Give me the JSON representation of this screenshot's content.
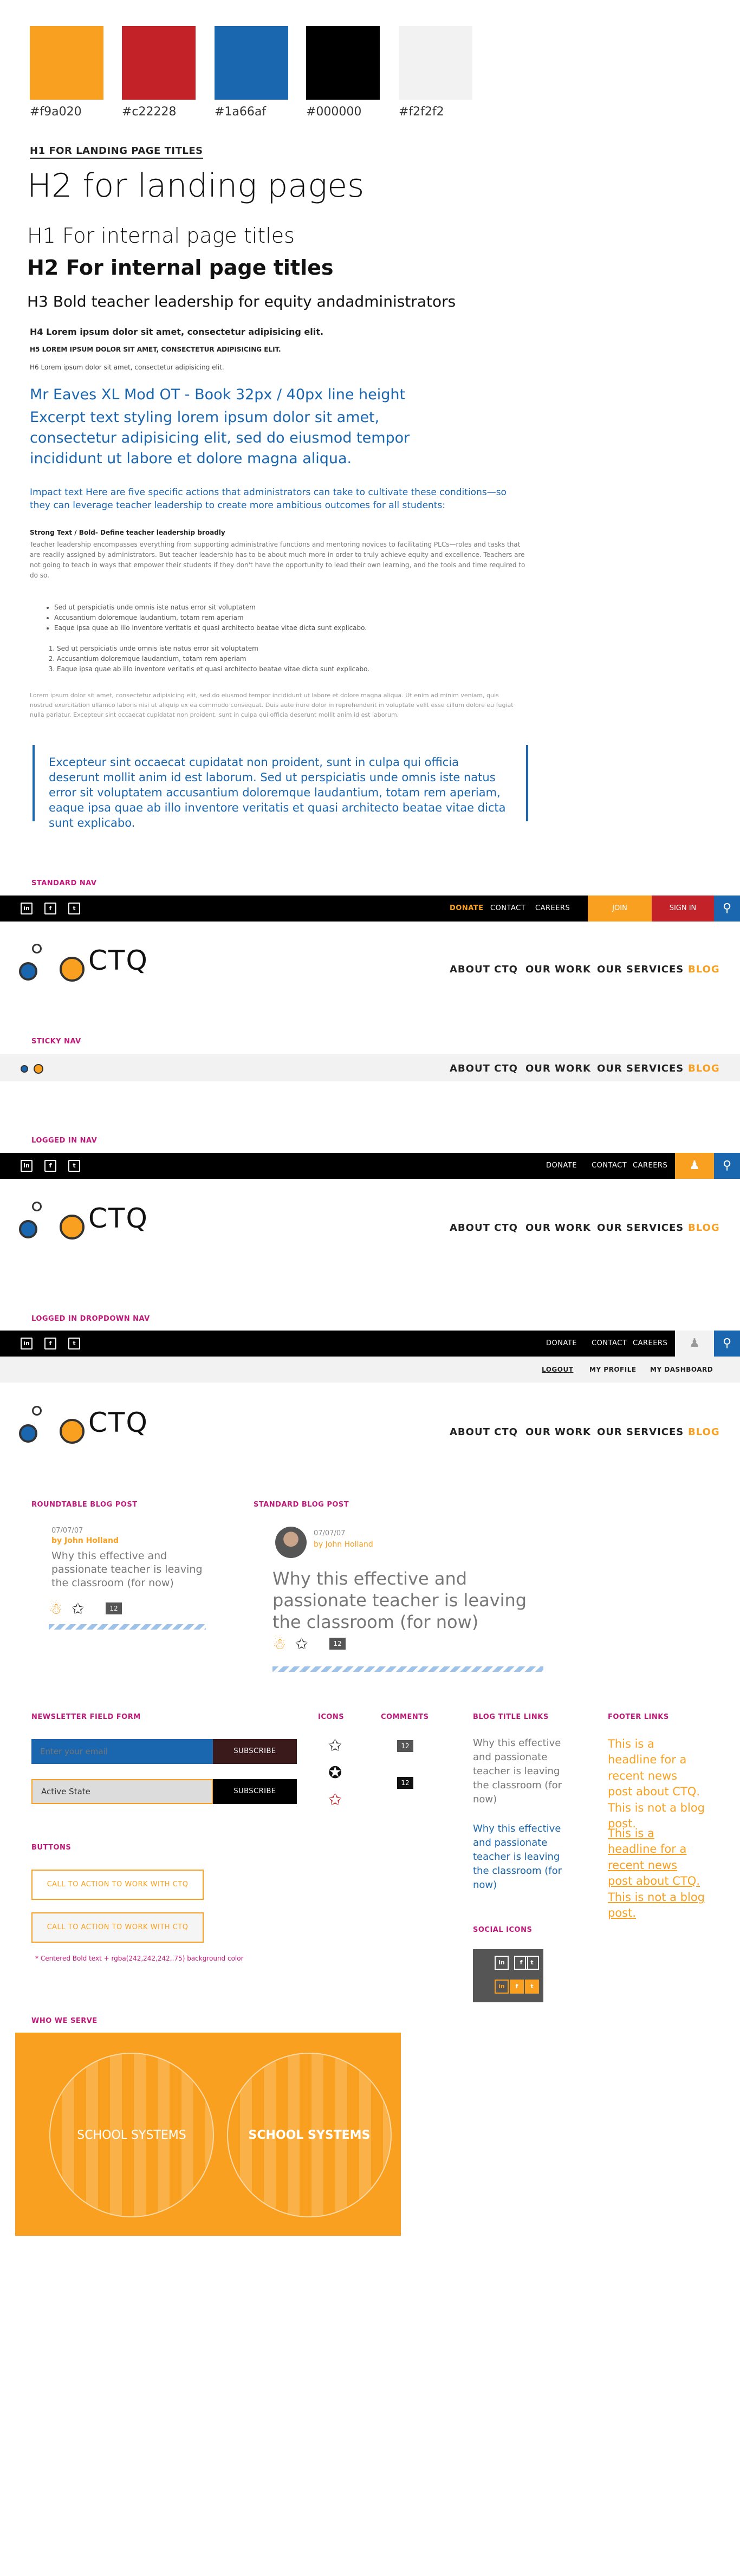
{
  "colors": [
    {
      "hex": "#f9a020",
      "label": "#f9a020"
    },
    {
      "hex": "#c22228",
      "label": "#c22228"
    },
    {
      "hex": "#1a66af",
      "label": "#1a66af"
    },
    {
      "hex": "#000000",
      "label": "#000000"
    },
    {
      "hex": "#f2f2f2",
      "label": "#f2f2f2"
    }
  ],
  "typography": {
    "h1_landing": "H1 FOR LANDING PAGE TITLES",
    "h2_landing": "H2 for landing pages",
    "h1_internal": "H1 For internal page titles",
    "h2_internal": "H2 For internal page titles",
    "h3": "H3 Bold teacher leadership for equity andadministrators",
    "h4": "H4 Lorem ipsum dolor sit amet, consectetur adipisicing elit.",
    "h5": "H5 LOREM IPSUM DOLOR SIT AMET, CONSECTETUR ADIPISICING ELIT.",
    "h6": "H6 Lorem ipsum dolor sit amet, consectetur adipisicing elit.",
    "eaves_label": "Mr Eaves XL Mod OT - Book 32px / 40px line height",
    "excerpt": "Excerpt text styling lorem ipsum dolor sit amet, consectetur adipisicing elit, sed do eiusmod tempor incididunt ut labore et dolore magna aliqua.",
    "impact": "Impact text Here are five specific actions that administrators can take to cultivate these conditions—so they can leverage teacher leadership to create more ambitious outcomes for all students:",
    "strong_label": "Strong Text / Bold- Define teacher leadership broadly",
    "body1": "Teacher leadership encompasses everything from supporting administrative functions and mentoring novices to facilitating PLCs—roles and tasks that are readily assigned by administrators. But teacher leadership has to be about much more in order to truly achieve equity and excellence. Teachers are not going to teach in ways that empower their students if they don't have the opportunity to lead their own learning, and the tools and time required to do so.",
    "bullets": [
      "Sed ut perspiciatis unde omnis iste natus error sit voluptatem",
      "Accusantium doloremque laudantium, totam rem aperiam",
      "Eaque ipsa quae ab illo inventore veritatis et quasi architecto beatae vitae dicta sunt explicabo."
    ],
    "numbered": [
      "Sed ut perspiciatis unde omnis iste natus error sit voluptatem",
      "Accusantium doloremque laudantium, totam rem aperiam",
      "Eaque ipsa quae ab illo inventore veritatis et quasi architecto beatae vitae dicta sunt explicabo."
    ],
    "body2": "Lorem ipsum dolor sit amet, consectetur adipisicing elit, sed do eiusmod tempor incididunt ut labore et dolore magna aliqua. Ut enim ad minim veniam, quis nostrud exercitation ullamco laboris nisi ut aliquip ex ea commodo consequat. Duis aute irure dolor in reprehenderit in voluptate velit esse cillum dolore eu fugiat nulla pariatur. Excepteur sint occaecat cupidatat non proident, sunt in culpa qui officia deserunt mollit anim id est laborum.",
    "quote": "Excepteur sint occaecat cupidatat non proident, sunt in culpa qui officia deserunt mollit anim id est laborum. Sed ut perspiciatis unde omnis iste natus error sit voluptatem accusantium doloremque laudantium, totam rem aperiam, eaque ipsa quae ab illo inventore veritatis et quasi architecto beatae vitae dicta sunt explicabo."
  },
  "sections": {
    "standard_nav": "STANDARD NAV",
    "sticky_nav": "STICKY NAV",
    "logged_in_nav": "LOGGED IN NAV",
    "logged_in_dropdown_nav": "LOGGED IN DROPDOWN NAV",
    "roundtable_blog_post": "ROUNDTABLE BLOG POST",
    "standard_blog_post": "STANDARD BLOG POST",
    "newsletter_field_form": "NEWSLETTER FIELD FORM",
    "icons": "ICONS",
    "comments": "COMMENTS",
    "blog_title_links": "BLOG TITLE LINKS",
    "footer_links": "FOOTER LINKS",
    "buttons": "BUTTONS",
    "social_icons": "SOCIAL ICONS",
    "who_we_serve": "WHO WE SERVE"
  },
  "social": {
    "linkedin": "in",
    "facebook": "f",
    "twitter": "t"
  },
  "topnav": {
    "donate": "DONATE",
    "contact": "CONTACT",
    "careers": "CAREERS",
    "join": "JOIN",
    "sign_in": "SIGN IN"
  },
  "dropdown": {
    "logout": "LOGOUT",
    "my_profile": "MY PROFILE",
    "my_dashboard": "MY DASHBOARD"
  },
  "logo_text": "CTQ",
  "mainnav": {
    "about": "ABOUT CTQ",
    "work": "OUR WORK",
    "services": "OUR SERVICES",
    "blog": "BLOG"
  },
  "roundtable": {
    "date": "07/07/07",
    "author": "by John Holland",
    "title": "Why this effective and passionate teacher is leaving the classroom (for now)",
    "comments": "12"
  },
  "standard_post": {
    "date": "07/07/07",
    "author": "by John Holland",
    "title": "Why this effective and passionate teacher is leaving the classroom (for now)",
    "comments": "12"
  },
  "newsletter": {
    "placeholder": "Enter your email",
    "active_value": "Active State",
    "subscribe": "SUBSCRIBE"
  },
  "comments_counts": [
    "12",
    "12"
  ],
  "blog_title_links": [
    "Why this effective and passionate teacher is leaving the classroom (for now)",
    "Why this effective and passionate teacher is leaving the classroom (for now)"
  ],
  "footer_links": [
    "This is a headline for a recent news post about CTQ. This is not a blog post.",
    "This is a headline for a recent news post about CTQ. This is not a blog post."
  ],
  "buttons": {
    "cta1": "CALL TO ACTION TO WORK WITH CTQ",
    "cta2": "CALL TO ACTION TO WORK WITH CTQ",
    "note": "* Centered Bold text + rgba(242,242,242,.75) background color"
  },
  "who_we_serve": {
    "left": "SCHOOL SYSTEMS",
    "right": "SCHOOL SYSTEMS"
  }
}
